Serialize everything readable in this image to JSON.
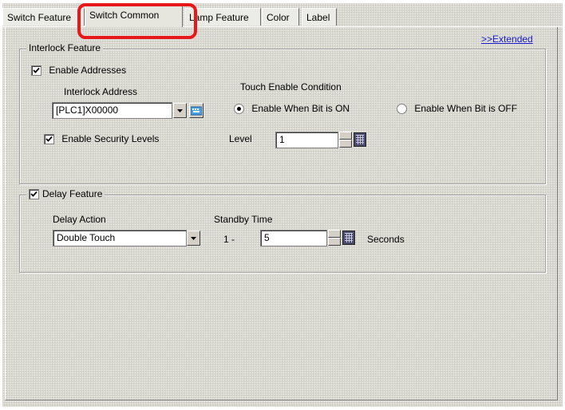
{
  "tabs": [
    {
      "label": "Switch Feature",
      "active": false
    },
    {
      "label": "Switch Common",
      "active": true
    },
    {
      "label": "Lamp Feature",
      "active": false
    },
    {
      "label": "Color",
      "active": false
    },
    {
      "label": "Label",
      "active": false
    }
  ],
  "extended_link": ">>Extended",
  "interlock": {
    "title": "Interlock Feature",
    "enable_addresses_label": "Enable Addresses",
    "enable_addresses_checked": true,
    "address_label": "Interlock Address",
    "address_value": "[PLC1]X00000",
    "touch_condition_label": "Touch Enable Condition",
    "radio_on_label": "Enable When Bit is ON",
    "radio_off_label": "Enable When Bit is OFF",
    "selected_condition": "on",
    "enable_security_label": "Enable Security Levels",
    "enable_security_checked": true,
    "level_label": "Level",
    "level_value": "1"
  },
  "delay": {
    "title": "Delay Feature",
    "checked": true,
    "action_label": "Delay Action",
    "action_value": "Double Touch",
    "standby_label": "Standby Time",
    "range_prefix": "1 -",
    "standby_value": "5",
    "seconds_label": "Seconds"
  },
  "colors": {
    "highlight": "#e8171a",
    "link": "#1a1acc"
  }
}
